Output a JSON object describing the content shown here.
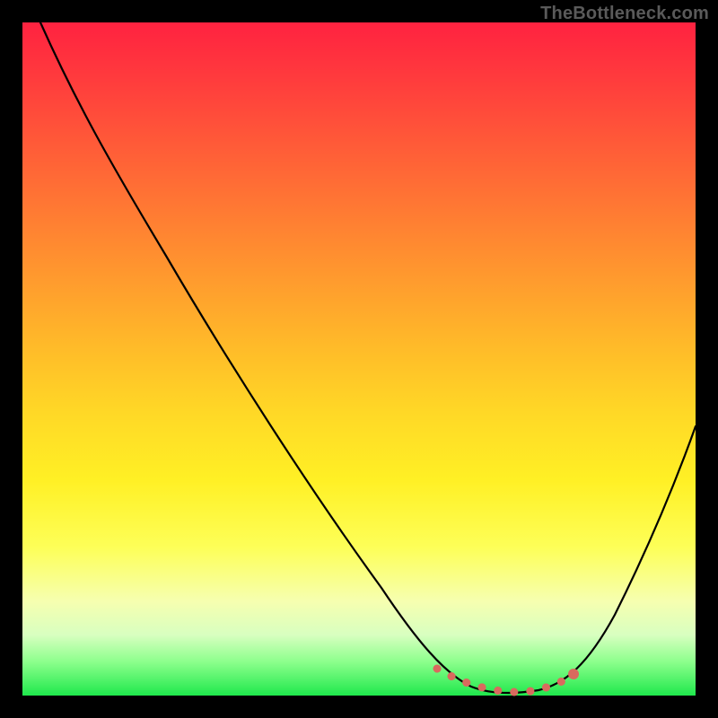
{
  "watermark": "TheBottleneck.com",
  "chart_data": {
    "type": "line",
    "title": "",
    "xlabel": "",
    "ylabel": "",
    "xlim": [
      0,
      100
    ],
    "ylim": [
      0,
      100
    ],
    "grid": false,
    "series": [
      {
        "name": "bottleneck-curve",
        "x": [
          0,
          10,
          20,
          30,
          40,
          50,
          55,
          60,
          65,
          70,
          75,
          80,
          85,
          90,
          95,
          100
        ],
        "values": [
          100,
          90,
          76,
          62,
          47,
          30,
          21,
          12,
          5,
          1,
          0,
          1,
          5,
          14,
          26,
          40
        ]
      }
    ],
    "optimal_zone": {
      "x_start": 62,
      "x_end": 80,
      "label": "optimal-match-dots"
    },
    "background_gradient": {
      "top": "#ff2240",
      "mid_top": "#ff9a2e",
      "mid_bottom": "#fdff58",
      "bottom": "#1fe84c"
    },
    "colors": {
      "curve": "#000000",
      "dots": "#d96a5e",
      "frame": "#000000",
      "watermark": "#5a5a5a"
    }
  }
}
